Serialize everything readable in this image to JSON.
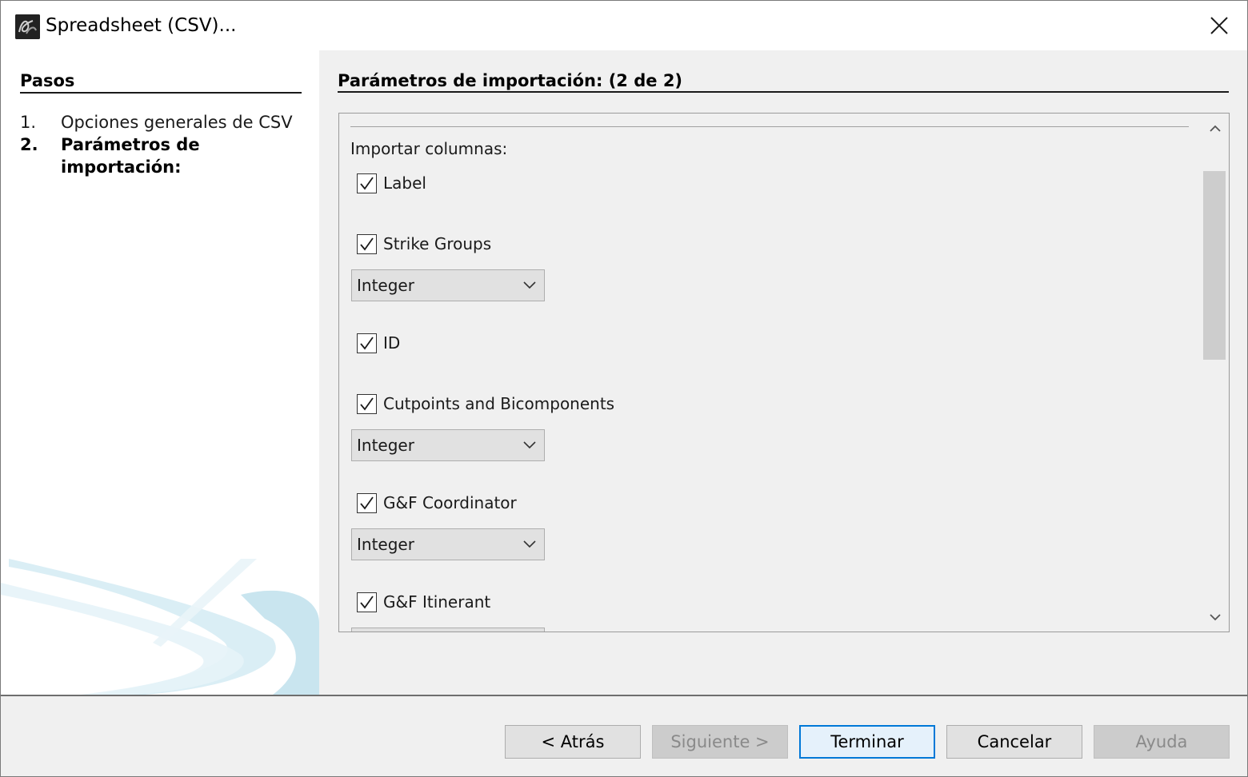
{
  "window": {
    "title": "Spreadsheet (CSV)..."
  },
  "steps": {
    "title": "Pasos",
    "items": [
      {
        "num": "1.",
        "label": "Opciones generales de CSV"
      },
      {
        "num": "2.",
        "label": "Parámetros de importación:"
      }
    ]
  },
  "content": {
    "section_title": "Parámetros de importación: (2 de 2)",
    "import_label": "Importar columnas:",
    "columns": [
      {
        "label": "Label",
        "checked": true
      },
      {
        "label": "Strike Groups",
        "checked": true,
        "type": "Integer"
      },
      {
        "label": "ID",
        "checked": true
      },
      {
        "label": "Cutpoints and Bicomponents",
        "checked": true,
        "type": "Integer"
      },
      {
        "label": "G&F Coordinator",
        "checked": true,
        "type": "Integer"
      },
      {
        "label": "G&F Itinerant",
        "checked": true
      }
    ]
  },
  "buttons": {
    "back": "< Atrás",
    "next": "Siguiente >",
    "finish": "Terminar",
    "cancel": "Cancelar",
    "help": "Ayuda"
  },
  "icons": {
    "app": "gephi-app-icon",
    "close": "close-icon",
    "check": "check-icon",
    "dropdown": "chevron-down-icon",
    "scroll_up": "chevron-up-icon",
    "scroll_down": "chevron-down-icon"
  },
  "colors": {
    "panel_bg": "#f0f0f0",
    "accent": "#0078d7",
    "button_bg": "#e1e1e1"
  }
}
